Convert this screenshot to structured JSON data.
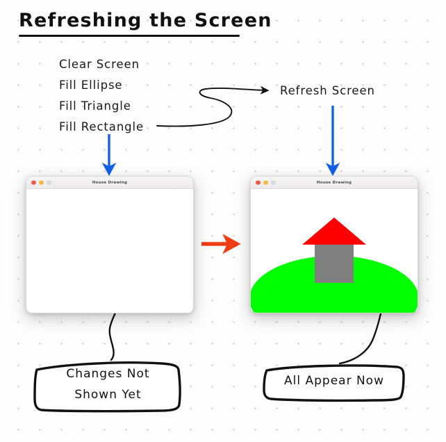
{
  "title": "Refreshing the Screen",
  "steps": [
    {
      "label": "Clear Screen"
    },
    {
      "label": "Fill Ellipse"
    },
    {
      "label": "Fill Triangle"
    },
    {
      "label": "Fill Rectangle"
    }
  ],
  "refresh_label": "Refresh Screen",
  "windows": {
    "empty": {
      "title": "House Drawing",
      "traffic_lights": [
        "close-red",
        "minimize-yellow",
        "zoom-gray"
      ]
    },
    "house": {
      "title": "House Drawing",
      "traffic_lights": [
        "close-red",
        "minimize-yellow",
        "zoom-gray"
      ],
      "shapes": {
        "hill_color": "#00FF00",
        "roof_color": "#FF0000",
        "body_color": "#808080"
      }
    }
  },
  "callouts": {
    "left": {
      "line1": "Changes Not",
      "line2": "Shown Yet"
    },
    "right": {
      "line1": "All Appear Now"
    }
  },
  "arrows": {
    "blue_color": "#1560E8",
    "red_color": "#F03C12",
    "black_color": "#111111"
  },
  "icons": {
    "down_arrow_left": "blue-down-arrow-icon",
    "down_arrow_right": "blue-down-arrow-icon",
    "transition_arrow": "red-right-arrow-icon",
    "curve_arrow": "black-curved-arrow-icon",
    "callout_pointer_left": "black-callout-pointer-icon",
    "callout_pointer_right": "black-callout-pointer-icon"
  }
}
